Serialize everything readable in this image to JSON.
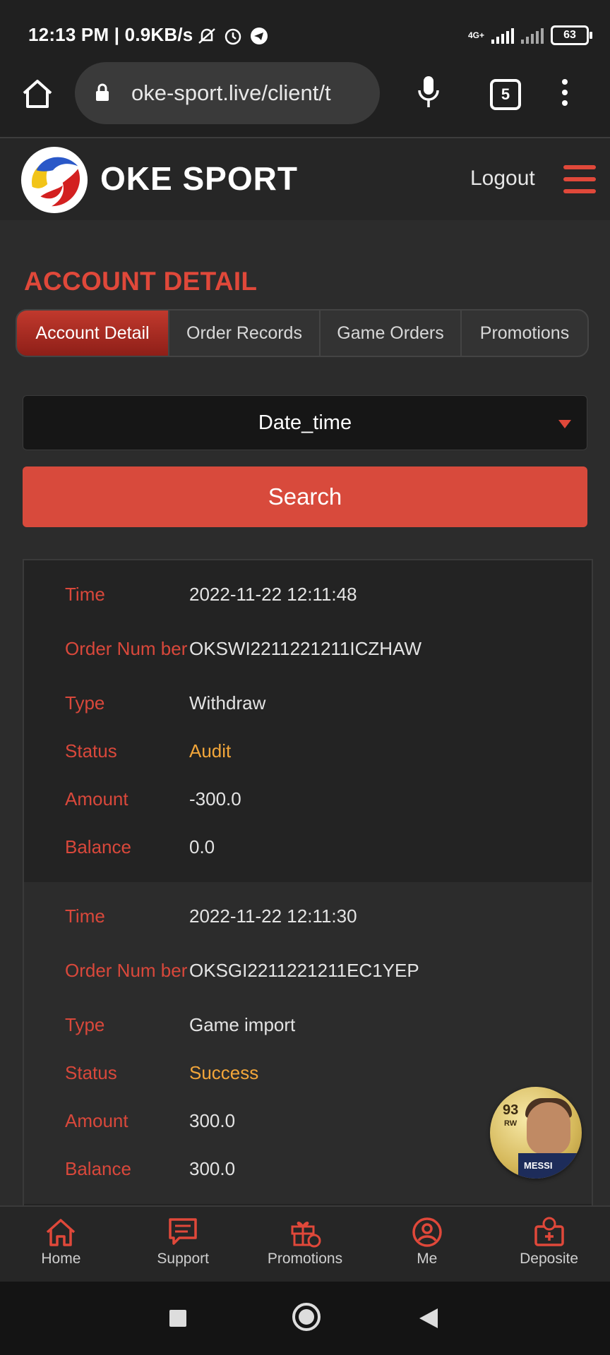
{
  "status_bar": {
    "time": "12:13 PM",
    "speed": "0.9KB/s",
    "network": "4G+",
    "battery": "63"
  },
  "browser": {
    "url": "oke-sport.live/client/t",
    "tab_count": "5"
  },
  "header": {
    "brand": "OKE SPORT",
    "logout": "Logout"
  },
  "page_title": "ACCOUNT DETAIL",
  "tabs": [
    {
      "label": "Account Detail",
      "active": true
    },
    {
      "label": "Order Records",
      "active": false
    },
    {
      "label": "Game Orders",
      "active": false
    },
    {
      "label": "Promotions",
      "active": false
    }
  ],
  "filter": {
    "selected": "Date_time",
    "search_label": "Search"
  },
  "labels": {
    "time": "Time",
    "order_number": "Order Num ber",
    "type": "Type",
    "status": "Status",
    "amount": "Amount",
    "balance": "Balance"
  },
  "records": [
    {
      "time": "2022-11-22 12:11:48",
      "order_number": "OKSWI2211221211ICZHAW",
      "type": "Withdraw",
      "status": "Audit",
      "amount": "-300.0",
      "balance": "0.0"
    },
    {
      "time": "2022-11-22 12:11:30",
      "order_number": "OKSGI2211221211EC1YEP",
      "type": "Game import",
      "status": "Success",
      "amount": "300.0",
      "balance": "300.0"
    }
  ],
  "floating_player": {
    "rating": "93",
    "position": "RW",
    "name": "MESSI"
  },
  "bottom_nav": [
    {
      "label": "Home",
      "icon": "home-icon"
    },
    {
      "label": "Support",
      "icon": "support-icon"
    },
    {
      "label": "Promotions",
      "icon": "gift-icon"
    },
    {
      "label": "Me",
      "icon": "user-icon"
    },
    {
      "label": "Deposite",
      "icon": "deposit-icon"
    }
  ],
  "colors": {
    "accent": "#e0483a",
    "status": "#f2a63a",
    "background": "#2c2c2c"
  }
}
